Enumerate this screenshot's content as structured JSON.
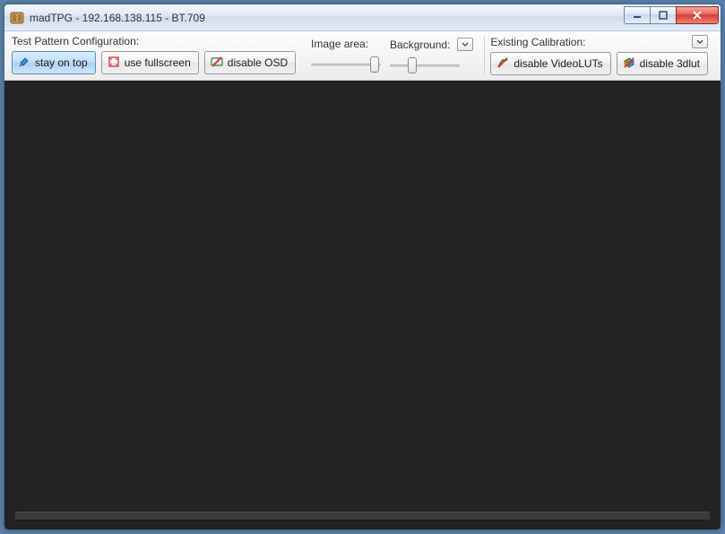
{
  "titlebar": {
    "title": "madTPG  -  192.168.138.115  -  BT.709"
  },
  "toolbar": {
    "test_pattern_label": "Test Pattern Configuration:",
    "stay_on_top": "stay on top",
    "use_fullscreen": "use fullscreen",
    "disable_osd": "disable OSD",
    "image_area_label": "Image area:",
    "background_label": "Background:",
    "calibration_label": "Existing Calibration:",
    "disable_videoluts": "disable VideoLUTs",
    "disable_3dlut": "disable 3dlut"
  },
  "sliders": {
    "image_area_pct": 95,
    "background_pct": 30
  }
}
